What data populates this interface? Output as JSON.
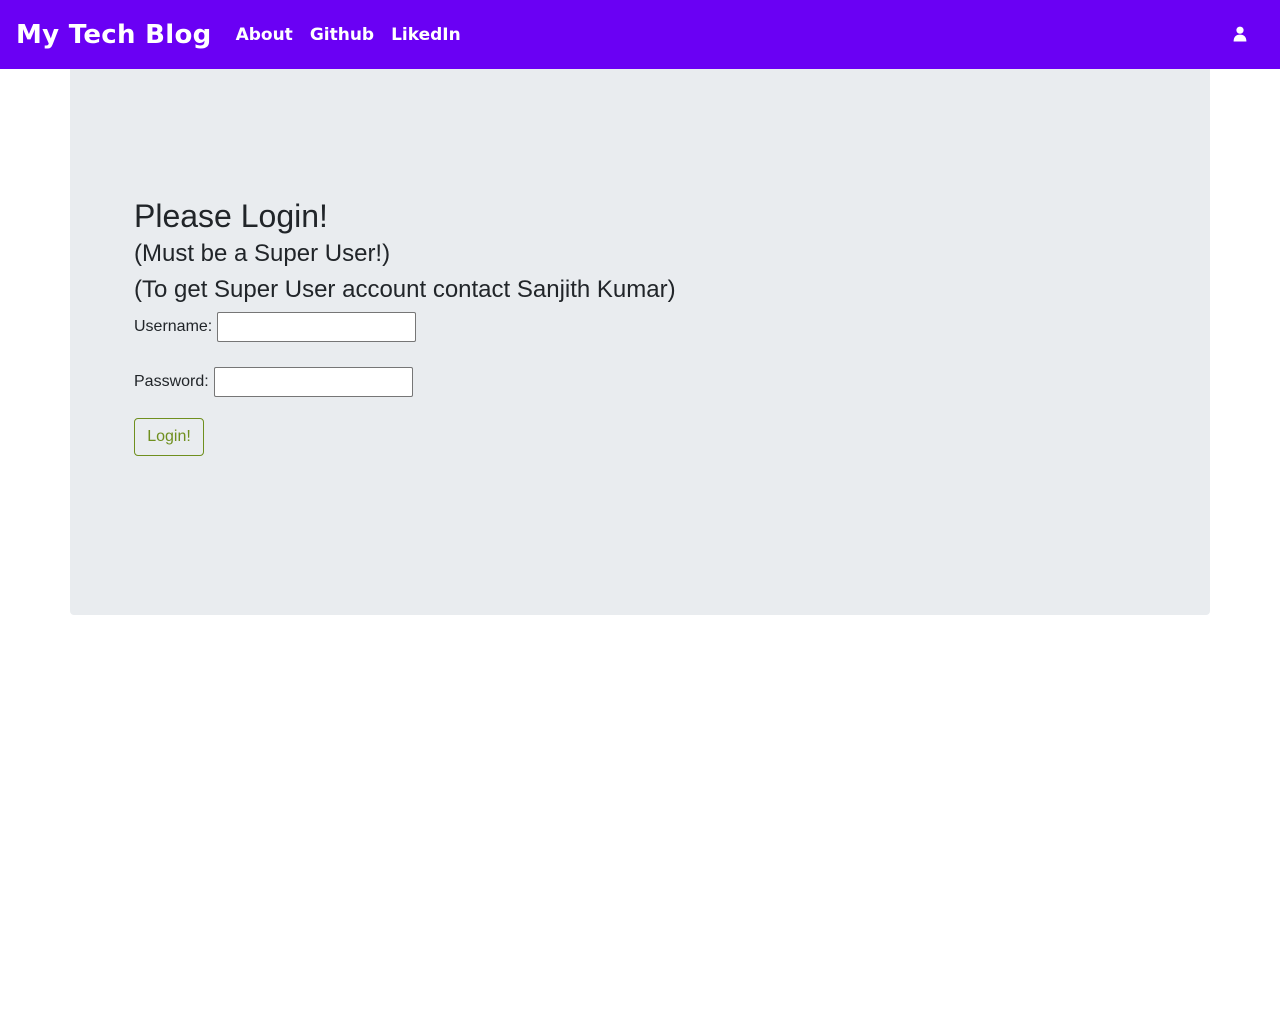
{
  "navbar": {
    "brand": "My Tech Blog",
    "links": [
      "About",
      "Github",
      "LikedIn"
    ],
    "user_icon": "user-icon",
    "bg_color": "#6a00f4"
  },
  "login": {
    "title": "Please Login!",
    "subtitle": "(Must be a Super User!)",
    "contact_note": "(To get Super User account contact Sanjith Kumar)",
    "username_label": "Username:",
    "username_value": "",
    "password_label": "Password:",
    "password_value": "",
    "submit_label": "Login!",
    "button_color": "#6f8f1e"
  }
}
